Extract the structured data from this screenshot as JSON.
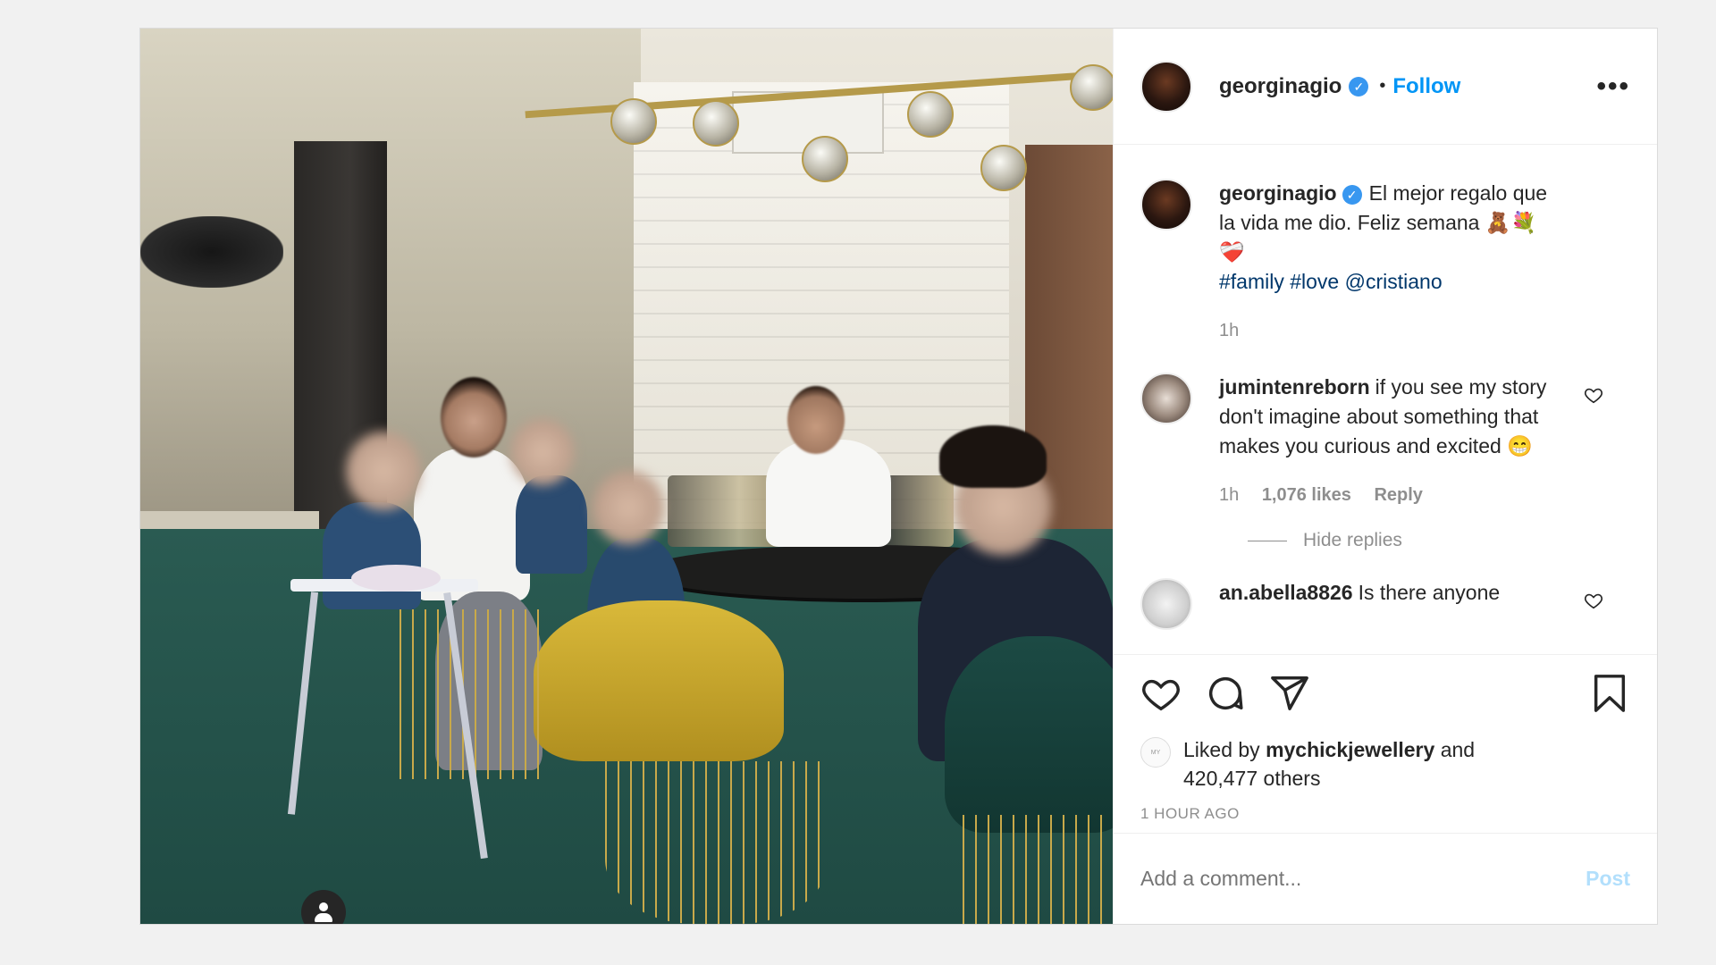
{
  "header": {
    "username": "georginagio",
    "verified_mark": "✓",
    "separator": "•",
    "follow_label": "Follow",
    "more_label": "•••"
  },
  "caption": {
    "username": "georginagio",
    "text": "El mejor regalo que la vida me dio. Feliz semana 🧸💐❤️‍🩹",
    "tags": "#family #love @cristiano",
    "time": "1h"
  },
  "comments": [
    {
      "username": "jumintenreborn",
      "text": "if you see my story don't imagine about something that makes you curious and excited 😁",
      "time": "1h",
      "likes": "1,076 likes",
      "reply_label": "Reply"
    },
    {
      "username": "an.abella8826",
      "text": "Is there anyone"
    }
  ],
  "hide_replies_label": "Hide replies",
  "likes": {
    "prefix": "Liked by",
    "user": "mychickjewellery",
    "joiner": "and",
    "others": "420,477 others",
    "mini_avatar_text": "MY"
  },
  "time_ago": "1 HOUR AGO",
  "add_comment": {
    "placeholder": "Add a comment...",
    "post_label": "Post"
  },
  "icons": [
    "heart-icon",
    "comment-icon",
    "share-icon",
    "bookmark-icon",
    "user-tag-icon",
    "more-icon",
    "verified-icon"
  ],
  "colors": {
    "accent": "#0095f6",
    "verified": "#3897f0",
    "muted": "#8e8e8e",
    "tag": "#00376b",
    "post_disabled": "#b2dffc"
  }
}
